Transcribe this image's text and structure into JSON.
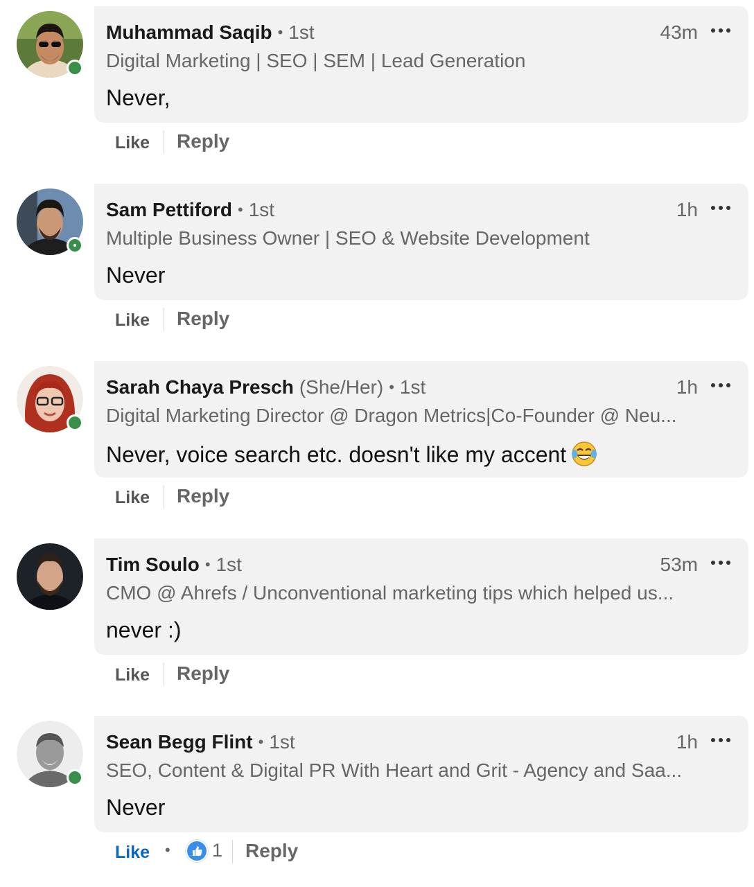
{
  "comments": [
    {
      "name": "Muhammad Saqib",
      "pronouns": "",
      "degree": "1st",
      "time": "43m",
      "headline": "Digital Marketing | SEO | SEM | Lead Generation",
      "text": "Never,",
      "like_label": "Like",
      "reply_label": "Reply"
    },
    {
      "name": "Sam Pettiford",
      "pronouns": "",
      "degree": "1st",
      "time": "1h",
      "headline": "Multiple Business Owner | SEO & Website Development",
      "text": "Never",
      "like_label": "Like",
      "reply_label": "Reply"
    },
    {
      "name": "Sarah Chaya Presch",
      "pronouns": "(She/Her)",
      "degree": "1st",
      "time": "1h",
      "headline": "Digital Marketing Director @ Dragon Metrics|Co-Founder @ Neu...",
      "text": "Never, voice search etc. doesn't like my accent",
      "emoji": "tears-of-joy-emoji",
      "like_label": "Like",
      "reply_label": "Reply"
    },
    {
      "name": "Tim Soulo",
      "pronouns": "",
      "degree": "1st",
      "time": "53m",
      "headline": "CMO @ Ahrefs / Unconventional marketing tips which helped us...",
      "text": "never :)",
      "like_label": "Like",
      "reply_label": "Reply"
    },
    {
      "name": "Sean Begg Flint",
      "pronouns": "",
      "degree": "1st",
      "time": "1h",
      "headline": "SEO, Content & Digital PR With Heart and Grit - Agency and Saa...",
      "text": "Never",
      "like_label": "Like",
      "liked": true,
      "reaction_count": "1",
      "reaction_icon": "thumbs-up-icon",
      "reply_label": "Reply"
    }
  ],
  "colors": {
    "bubble": "#f2f2f2",
    "presence": "#3a8f4a",
    "like_active": "#0a66c2",
    "muted": "#666666"
  }
}
